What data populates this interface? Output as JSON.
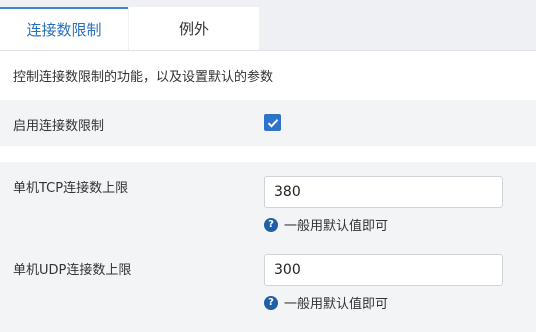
{
  "tabs": [
    {
      "label": "连接数限制",
      "active": true
    },
    {
      "label": "例外",
      "active": false
    }
  ],
  "description": "控制连接数限制的功能，以及设置默认的参数",
  "enable": {
    "label": "启用连接数限制",
    "checked": true,
    "icon": "checkmark-icon"
  },
  "tcp": {
    "label": "单机TCP连接数上限",
    "value": "380",
    "hint": "一般用默认值即可",
    "hint_icon": "question-icon"
  },
  "udp": {
    "label": "单机UDP连接数上限",
    "value": "300",
    "hint": "一般用默认值即可",
    "hint_icon": "question-icon"
  },
  "colors": {
    "accent": "#2d73c9",
    "tab_active_text": "#2a6fbc",
    "hint_icon": "#1f5ea8"
  }
}
